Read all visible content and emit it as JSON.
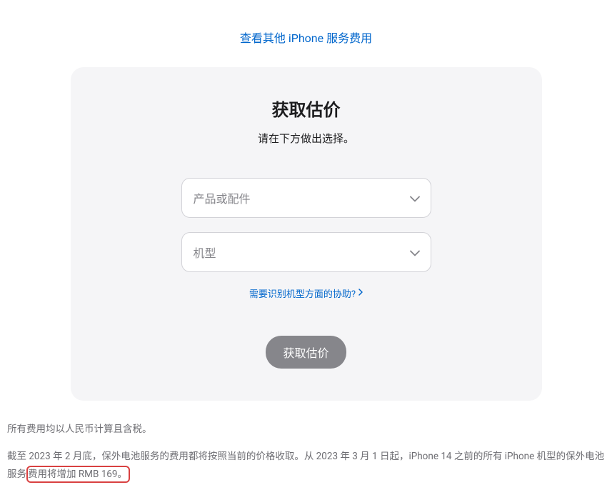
{
  "topLink": {
    "label": "查看其他 iPhone 服务费用"
  },
  "card": {
    "title": "获取估价",
    "subtitle": "请在下方做出选择。",
    "select1": {
      "placeholder": "产品或配件"
    },
    "select2": {
      "placeholder": "机型"
    },
    "helpLink": {
      "label": "需要识别机型方面的协助?"
    },
    "submitButton": {
      "label": "获取估价"
    }
  },
  "footer": {
    "line1": "所有费用均以人民币计算且含税。",
    "line2_part1": "截至 2023 年 2 月底，保外电池服务的费用都将按照当前的价格收取。从 2023 年 3 月 1 日起，iPhone 14 之前的所有 iPhone 机型的保外电池服务",
    "line2_highlight": "费用将增加 RMB 169。"
  }
}
